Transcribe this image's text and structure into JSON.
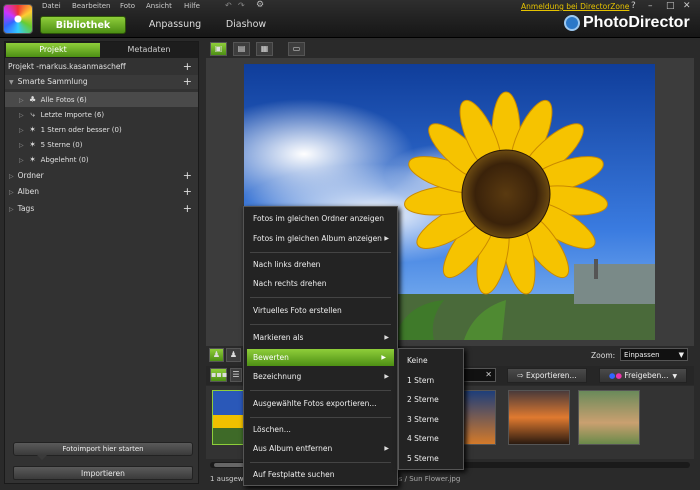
{
  "header": {
    "menu": [
      "Datei",
      "Bearbeiten",
      "Foto",
      "Ansicht",
      "Hilfe"
    ],
    "tabs": [
      "Bibliothek",
      "Anpassung",
      "Diashow"
    ],
    "zone_link": "Anmeldung bei DirectorZone",
    "window_buttons": [
      "?",
      "–",
      "□",
      "✕"
    ],
    "brand": "PhotoDirector"
  },
  "left": {
    "tabs": [
      "Projekt",
      "Metadaten"
    ],
    "project": "Projekt -markus.kasanmascheff",
    "smart_collection": "Smarte Sammlung",
    "smart_items": [
      "Alle Fotos (6)",
      "Letzte Importe (6)",
      "1 Stern oder besser (0)",
      "5 Sterne (0)",
      "Abgelehnt (0)"
    ],
    "sections": [
      "Ordner",
      "Alben",
      "Tags"
    ],
    "import_start": "Fotoimport hier starten",
    "import_button": "Importieren"
  },
  "viewer": {
    "zoom_label": "Zoom:",
    "zoom_value": "Einpassen",
    "export": "Exportieren...",
    "share": "Freigeben..."
  },
  "status": {
    "left": "1 ausgew",
    "path": "Sammlung / Alle Fotos / Sun Flower.jpg"
  },
  "context_menu": {
    "items": [
      "Fotos im gleichen Ordner anzeigen",
      "Fotos im gleichen Album anzeigen",
      "Nach links drehen",
      "Nach rechts drehen",
      "Virtuelles Foto erstellen",
      "Markieren als",
      "Bewerten",
      "Bezeichnung",
      "Ausgewählte Fotos exportieren...",
      "Löschen...",
      "Aus Album entfernen",
      "Auf Festplatte suchen"
    ],
    "rating_submenu": [
      "Keine",
      "1 Stern",
      "2 Sterne",
      "3 Sterne",
      "4 Sterne",
      "5 Sterne"
    ]
  },
  "colors": {
    "accent": "#6aaa22",
    "zone_link": "#e6c300",
    "brand_icon": "#2b78c8"
  }
}
